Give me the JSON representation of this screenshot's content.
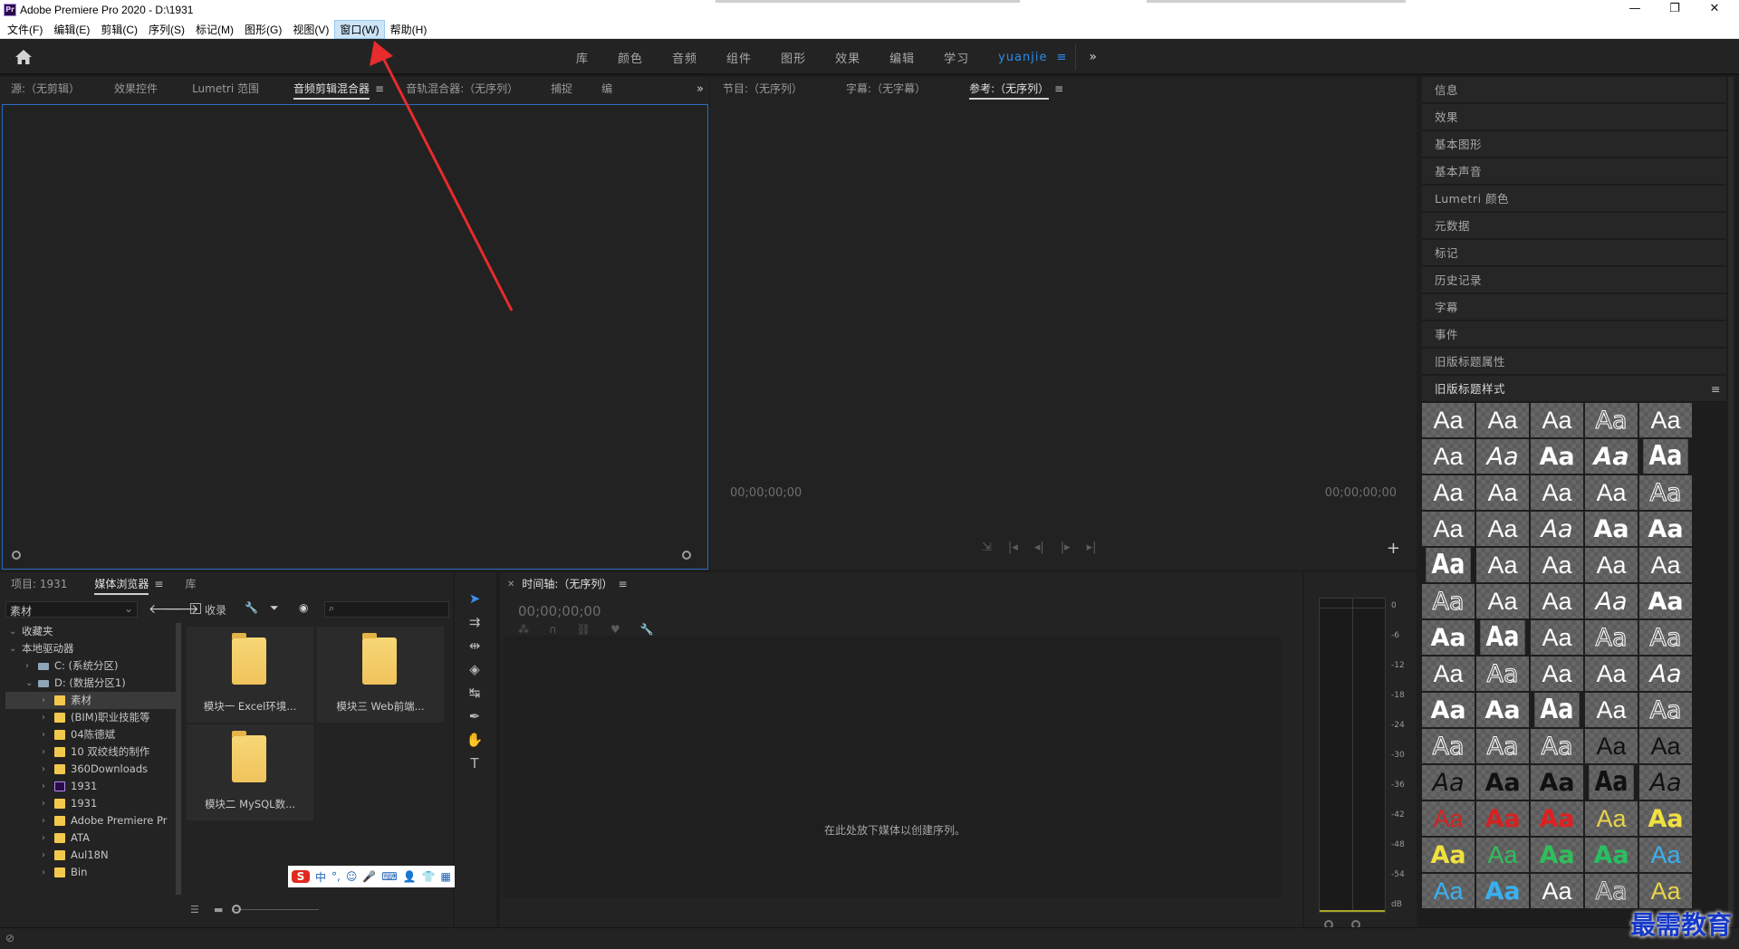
{
  "window": {
    "title": "Adobe Premiere Pro 2020 - D:\\1931",
    "app_icon": "Pr",
    "minimize": "—",
    "maximize": "❐",
    "close": "✕"
  },
  "menu": [
    "文件(F)",
    "编辑(E)",
    "剪辑(C)",
    "序列(S)",
    "标记(M)",
    "图形(G)",
    "视图(V)",
    "窗口(W)",
    "帮助(H)"
  ],
  "menu_active": "窗口(W)",
  "workspace": {
    "tabs": [
      "库",
      "颜色",
      "音频",
      "组件",
      "图形",
      "效果",
      "编辑",
      "学习"
    ],
    "user": "yuanjie",
    "more": "»"
  },
  "source_panel": {
    "tabs": [
      "源:（无剪辑）",
      "效果控件",
      "Lumetri 范围",
      "音频剪辑混合器",
      "音轨混合器:（无序列）",
      "捕捉",
      "编"
    ],
    "active": "音频剪辑混合器"
  },
  "program_panel": {
    "tabs": [
      "节目:（无序列）",
      "字幕:（无字幕）",
      "参考:（无序列）"
    ],
    "active": "参考:（无序列）",
    "timecode_left": "00;00;00;00",
    "timecode_right": "00;00;00;00"
  },
  "right_panel": {
    "items": [
      "信息",
      "效果",
      "基本图形",
      "基本声音",
      "Lumetri 颜色",
      "元数据",
      "标记",
      "历史记录",
      "字幕",
      "事件",
      "旧版标题属性",
      "旧版标题样式"
    ]
  },
  "project_panel": {
    "tabs": [
      "项目: 1931",
      "媒体浏览器",
      "库"
    ],
    "active": "媒体浏览器",
    "location": "素材",
    "ingest_label": "收录",
    "tree": [
      {
        "label": "收藏夹",
        "indent": 0,
        "expanded": true
      },
      {
        "label": "本地驱动器",
        "indent": 0,
        "expanded": true
      },
      {
        "label": "C: (系统分区)",
        "indent": 1,
        "drive": true
      },
      {
        "label": "D: (数据分区1)",
        "indent": 1,
        "drive": true,
        "expanded": true
      },
      {
        "label": "素材",
        "indent": 2,
        "selected": true
      },
      {
        "label": "(BIM)职业技能等",
        "indent": 2
      },
      {
        "label": "04陈德斌",
        "indent": 2
      },
      {
        "label": "10 双绞线的制作",
        "indent": 2
      },
      {
        "label": "360Downloads",
        "indent": 2
      },
      {
        "label": "1931",
        "indent": 2,
        "pr": true
      },
      {
        "label": "1931",
        "indent": 2
      },
      {
        "label": "Adobe Premiere Pr",
        "indent": 2
      },
      {
        "label": "ATA",
        "indent": 2
      },
      {
        "label": "Aul18N",
        "indent": 2
      },
      {
        "label": "Bin",
        "indent": 2
      }
    ],
    "tiles": [
      "模块一 Excel环境...",
      "模块三 Web前端...",
      "模块二 MySQL数..."
    ]
  },
  "ime": {
    "logo": "S",
    "items": [
      "中",
      "°,",
      "☺",
      "🎤",
      "⌨",
      "👤",
      "👕",
      "▦"
    ]
  },
  "timeline": {
    "title": "时间轴:（无序列）",
    "timecode": "00;00;00;00",
    "hint": "在此处放下媒体以创建序列。"
  },
  "meter": {
    "scale": [
      "0",
      "-6",
      "-12",
      "-18",
      "-24",
      "-30",
      "-36",
      "-42",
      "-48",
      "-54",
      "dB"
    ]
  },
  "watermark": "最需教育",
  "colors": {
    "accent": "#2d8ceb",
    "panel_focus": "#2b6cc4",
    "annotation_arrow": "#e82b2b"
  },
  "icons": [
    "home-icon",
    "hamburger-icon",
    "overflow-icon",
    "back-arrow-icon",
    "forward-arrow-icon",
    "wrench-icon",
    "filter-icon",
    "eye-icon",
    "search-icon",
    "selection-tool-icon",
    "track-select-icon",
    "ripple-edit-icon",
    "razor-icon",
    "slip-icon",
    "pen-icon",
    "hand-icon",
    "type-icon",
    "add-icon"
  ],
  "title_styles": [
    [
      {
        "c": "#fff",
        "st": "thin"
      },
      {
        "c": "#fff",
        "st": "thin"
      },
      {
        "c": "#fff",
        "st": "thin"
      },
      {
        "c": "#fff",
        "st": "outline"
      },
      {
        "c": "#fff",
        "st": "thin"
      }
    ],
    [
      {
        "c": "#fff",
        "st": "thin"
      },
      {
        "c": "#fff",
        "st": "italic"
      },
      {
        "c": "#fff",
        "st": "bold"
      },
      {
        "c": "#fff",
        "st": "bolditalic"
      },
      {
        "c": "#fff",
        "st": "heavy"
      }
    ],
    [
      {
        "c": "#fff",
        "st": "thin"
      },
      {
        "c": "#fff",
        "st": "thin"
      },
      {
        "c": "#fff",
        "st": "thin"
      },
      {
        "c": "#fff",
        "st": "thin"
      },
      {
        "c": "#fff",
        "st": "outline"
      }
    ],
    [
      {
        "c": "#fff",
        "st": "thin"
      },
      {
        "c": "#fff",
        "st": "thin"
      },
      {
        "c": "#fff",
        "st": "italic"
      },
      {
        "c": "#fff",
        "st": "bold"
      },
      {
        "c": "#fff",
        "st": "bold"
      }
    ],
    [
      {
        "c": "#fff",
        "st": "heavy"
      },
      {
        "c": "#fff",
        "st": "thin"
      },
      {
        "c": "#fff",
        "st": "thin"
      },
      {
        "c": "#fff",
        "st": "thin"
      },
      {
        "c": "#fff",
        "st": "thin"
      }
    ],
    [
      {
        "c": "#fff",
        "st": "outline"
      },
      {
        "c": "#fff",
        "st": "thin"
      },
      {
        "c": "#fff",
        "st": "thin"
      },
      {
        "c": "#fff",
        "st": "italic"
      },
      {
        "c": "#fff",
        "st": "bold"
      }
    ],
    [
      {
        "c": "#fff",
        "st": "bold"
      },
      {
        "c": "#fff",
        "st": "heavy"
      },
      {
        "c": "#fff",
        "st": "thin"
      },
      {
        "c": "#fff",
        "st": "outline"
      },
      {
        "c": "#fff",
        "st": "outline"
      }
    ],
    [
      {
        "c": "#fff",
        "st": "thin"
      },
      {
        "c": "#fff",
        "st": "outline"
      },
      {
        "c": "#fff",
        "st": "thin"
      },
      {
        "c": "#fff",
        "st": "thin"
      },
      {
        "c": "#fff",
        "st": "italic"
      }
    ],
    [
      {
        "c": "#fff",
        "st": "bold"
      },
      {
        "c": "#fff",
        "st": "bold"
      },
      {
        "c": "#fff",
        "st": "heavy"
      },
      {
        "c": "#fff",
        "st": "thin"
      },
      {
        "c": "#fff",
        "st": "outline"
      }
    ],
    [
      {
        "c": "#fff",
        "st": "outline"
      },
      {
        "c": "#fff",
        "st": "outline"
      },
      {
        "c": "#fff",
        "st": "outline"
      },
      {
        "c": "#111",
        "st": "thin"
      },
      {
        "c": "#111",
        "st": "thin"
      }
    ],
    [
      {
        "c": "#111",
        "st": "italic"
      },
      {
        "c": "#111",
        "st": "bold"
      },
      {
        "c": "#111",
        "st": "bold"
      },
      {
        "c": "#111",
        "st": "heavy"
      },
      {
        "c": "#111",
        "st": "italic"
      }
    ],
    [
      {
        "c": "#d42222",
        "st": "thin"
      },
      {
        "c": "#d42222",
        "st": "bold"
      },
      {
        "c": "#e02020",
        "st": "bold"
      },
      {
        "c": "#e8d44a",
        "st": "thin"
      },
      {
        "c": "#f0e040",
        "st": "bold"
      }
    ],
    [
      {
        "c": "#f0e040",
        "st": "bold"
      },
      {
        "c": "#2fbf5a",
        "st": "thin"
      },
      {
        "c": "#2fbf5a",
        "st": "bold"
      },
      {
        "c": "#28c060",
        "st": "bold"
      },
      {
        "c": "#3ab0f0",
        "st": "thin"
      }
    ],
    [
      {
        "c": "#3ab0f0",
        "st": "thin"
      },
      {
        "c": "#3ab0f0",
        "st": "bold"
      },
      {
        "c": "#fff",
        "st": "thin"
      },
      {
        "c": "#ddd",
        "st": "outline"
      },
      {
        "c": "#e8d44a",
        "st": "thin"
      }
    ]
  ]
}
